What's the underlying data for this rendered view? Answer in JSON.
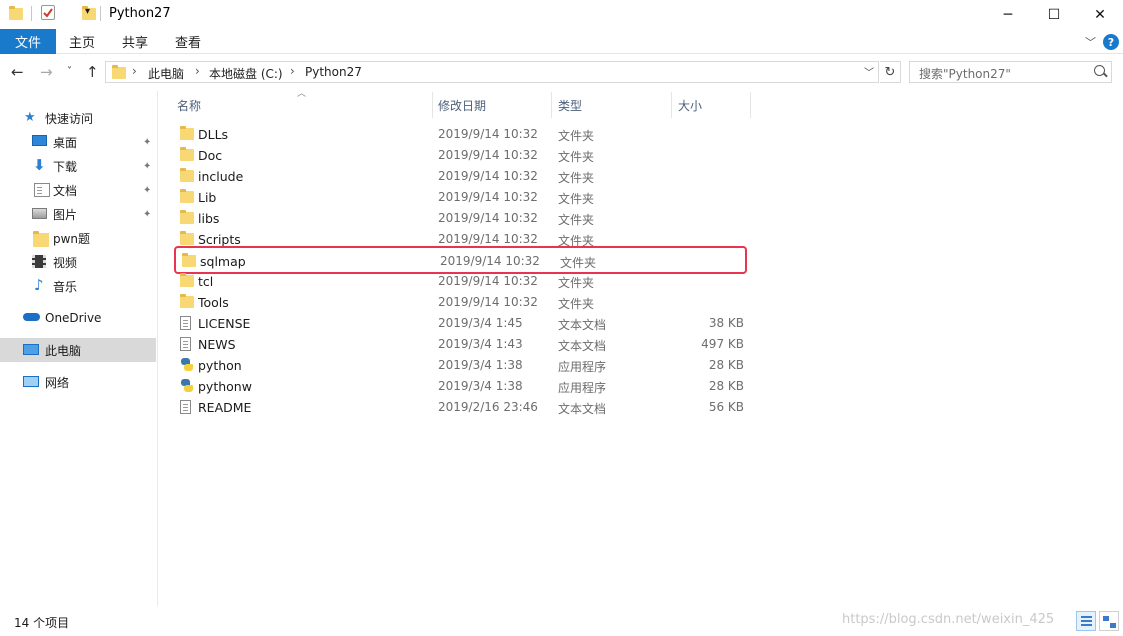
{
  "window": {
    "title": "Python27",
    "minimize": "─",
    "maximize": "☐",
    "close": "✕"
  },
  "ribbon": {
    "file_tab": "文件",
    "tabs": [
      "主页",
      "共享",
      "查看"
    ],
    "help": "?"
  },
  "address": {
    "crumbs": [
      "此电脑",
      "本地磁盘 (C:)",
      "Python27"
    ],
    "separator": "›",
    "search_placeholder": "搜索\"Python27\""
  },
  "nav": {
    "items": [
      {
        "label": "快速访问",
        "icon": "star-icon",
        "pinned": false
      },
      {
        "label": "桌面",
        "icon": "desktop-icon",
        "pinned": true
      },
      {
        "label": "下载",
        "icon": "download-icon",
        "pinned": true
      },
      {
        "label": "文档",
        "icon": "documents-icon",
        "pinned": true
      },
      {
        "label": "图片",
        "icon": "pictures-icon",
        "pinned": true
      },
      {
        "label": "pwn题",
        "icon": "folder-icon",
        "pinned": false
      },
      {
        "label": "视频",
        "icon": "video-icon",
        "pinned": false
      },
      {
        "label": "音乐",
        "icon": "music-icon",
        "pinned": false
      },
      {
        "label": "OneDrive",
        "icon": "cloud-icon",
        "pinned": false
      },
      {
        "label": "此电脑",
        "icon": "computer-icon",
        "pinned": false,
        "selected": true
      },
      {
        "label": "网络",
        "icon": "network-icon",
        "pinned": false
      }
    ],
    "pin_glyph": "📌"
  },
  "columns": {
    "name": "名称",
    "date": "修改日期",
    "type": "类型",
    "size": "大小"
  },
  "files": [
    {
      "name": "DLLs",
      "date": "2019/9/14 10:32",
      "type": "文件夹",
      "size": "",
      "icon": "folder-icon"
    },
    {
      "name": "Doc",
      "date": "2019/9/14 10:32",
      "type": "文件夹",
      "size": "",
      "icon": "folder-icon"
    },
    {
      "name": "include",
      "date": "2019/9/14 10:32",
      "type": "文件夹",
      "size": "",
      "icon": "folder-icon"
    },
    {
      "name": "Lib",
      "date": "2019/9/14 10:32",
      "type": "文件夹",
      "size": "",
      "icon": "folder-icon"
    },
    {
      "name": "libs",
      "date": "2019/9/14 10:32",
      "type": "文件夹",
      "size": "",
      "icon": "folder-icon"
    },
    {
      "name": "Scripts",
      "date": "2019/9/14 10:32",
      "type": "文件夹",
      "size": "",
      "icon": "folder-icon"
    },
    {
      "name": "sqlmap",
      "date": "2019/9/14 10:32",
      "type": "文件夹",
      "size": "",
      "icon": "folder-icon",
      "highlighted": true
    },
    {
      "name": "tcl",
      "date": "2019/9/14 10:32",
      "type": "文件夹",
      "size": "",
      "icon": "folder-icon"
    },
    {
      "name": "Tools",
      "date": "2019/9/14 10:32",
      "type": "文件夹",
      "size": "",
      "icon": "folder-icon"
    },
    {
      "name": "LICENSE",
      "date": "2019/3/4 1:45",
      "type": "文本文档",
      "size": "38 KB",
      "icon": "text-file-icon"
    },
    {
      "name": "NEWS",
      "date": "2019/3/4 1:43",
      "type": "文本文档",
      "size": "497 KB",
      "icon": "text-file-icon"
    },
    {
      "name": "python",
      "date": "2019/3/4 1:38",
      "type": "应用程序",
      "size": "28 KB",
      "icon": "python-icon"
    },
    {
      "name": "pythonw",
      "date": "2019/3/4 1:38",
      "type": "应用程序",
      "size": "28 KB",
      "icon": "python-icon"
    },
    {
      "name": "README",
      "date": "2019/2/16 23:46",
      "type": "文本文档",
      "size": "56 KB",
      "icon": "text-file-icon"
    }
  ],
  "status": {
    "item_count": "14 个项目",
    "watermark": "https://blog.csdn.net/weixin_425"
  },
  "colors": {
    "accent": "#1979ca",
    "highlight_border": "#e8344e",
    "folder": "#f8d775"
  }
}
